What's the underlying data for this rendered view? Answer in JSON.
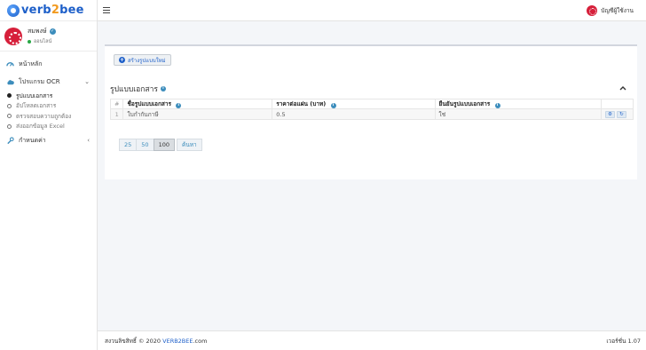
{
  "brand": {
    "logo_part1": "verb",
    "logo_part2": "2",
    "logo_part3": "bee"
  },
  "user": {
    "name": "สมพงษ์",
    "status": "ออนไลน์"
  },
  "topbar": {
    "account_label": "บัญชีผู้ใช้งาน"
  },
  "sidebar": {
    "items": [
      {
        "label": "หน้าหลัก",
        "icon": "dashboard-icon"
      },
      {
        "label": "โปรแกรม OCR",
        "icon": "cloud-icon"
      },
      {
        "label": "กำหนดค่า",
        "icon": "wrench-icon"
      }
    ],
    "sub_items": [
      {
        "label": "รูปแบบเอกสาร",
        "active": true
      },
      {
        "label": "อัปโหลดเอกสาร",
        "active": false
      },
      {
        "label": "ตรวจสอบความถูกต้อง",
        "active": false
      },
      {
        "label": "ส่งออกข้อมูล Excel",
        "active": false
      }
    ]
  },
  "main": {
    "create_button": "สร้างรูปแบบใหม่",
    "section_title": "รูปแบบเอกสาร",
    "table": {
      "headers": [
        "#",
        "ชื่อรูปแบบเอกสาร",
        "ราคาต่อแผ่น (บาท)",
        "ยืนยันรูปแบบเอกสาร"
      ],
      "rows": [
        {
          "index": "1",
          "name": "ใบกำกับภาษี",
          "price": "0.5",
          "confirmed": "ใช่"
        }
      ]
    },
    "pager": {
      "sizes": [
        "25",
        "50",
        "100"
      ],
      "active": "100",
      "search_label": "ค้นหา"
    }
  },
  "footer": {
    "copyright": "สงวนลิขสิทธิ์ © 2020",
    "brand": "VERB2BEE",
    "domain": ".com",
    "version": "เวอร์ชั่น 1.07"
  },
  "colors": {
    "accent": "#1d5fc9",
    "logo_orange": "#f29a1f",
    "avatar": "#d61f3a",
    "online": "#28a745"
  }
}
